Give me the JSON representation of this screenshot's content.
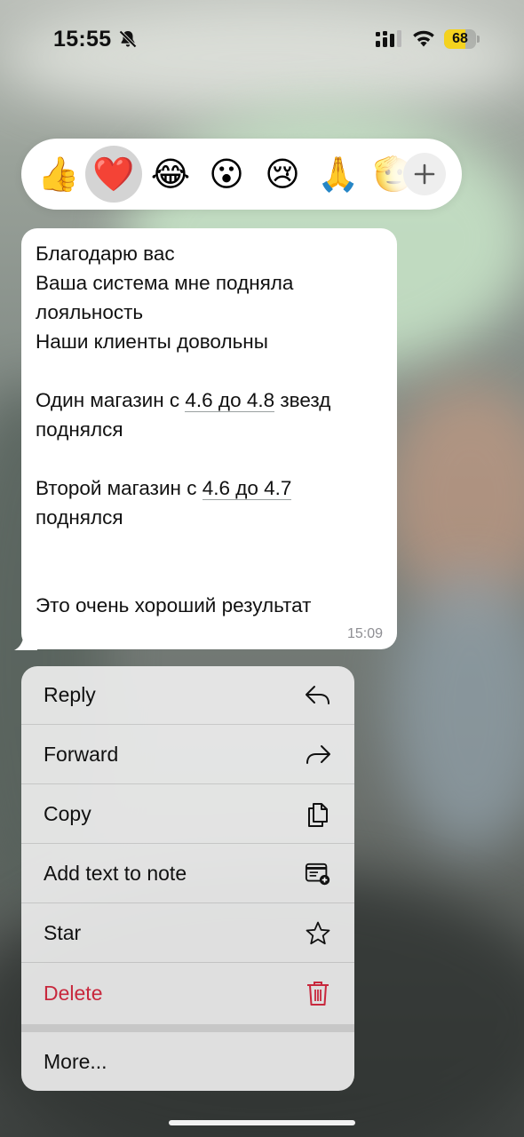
{
  "status_bar": {
    "time": "15:55",
    "silent_icon": "bell-slash-icon",
    "signal_icon": "cellular-signal-icon",
    "wifi_icon": "wifi-icon",
    "battery_level": "68",
    "battery_color": "#f4d21e"
  },
  "reactions": {
    "items": [
      {
        "emoji": "👍",
        "name": "thumbs-up"
      },
      {
        "emoji": "❤️",
        "name": "red-heart",
        "selected": true
      },
      {
        "emoji": "😂",
        "name": "face-with-tears-of-joy"
      },
      {
        "emoji": "😮",
        "name": "face-with-open-mouth"
      },
      {
        "emoji": "😢",
        "name": "crying-face"
      },
      {
        "emoji": "🙏",
        "name": "folded-hands"
      },
      {
        "emoji": "🫡",
        "name": "saluting-face-partial"
      }
    ],
    "more_icon": "plus-icon"
  },
  "message": {
    "lines": [
      "Благодарю вас",
      "Ваша система мне подняла",
      "лояльность",
      "Наши клиенты довольны",
      "",
      "Один магазин с 4.6 до 4.8 звезд",
      "поднялся",
      "",
      "Второй магазин с 4.6 до 4.7",
      "поднялся",
      "",
      "",
      "Это очень хороший результат"
    ],
    "line6_prefix": "Один магазин с ",
    "line6_link": "4.6 до 4.8",
    "line6_suffix": " звезд",
    "line9_prefix": "Второй магазин с ",
    "line9_link": "4.6 до 4.7",
    "time": "15:09"
  },
  "context_menu": {
    "reply": {
      "label": "Reply",
      "icon": "reply-arrow-icon"
    },
    "forward": {
      "label": "Forward",
      "icon": "forward-arrow-icon"
    },
    "copy": {
      "label": "Copy",
      "icon": "copy-icon"
    },
    "add_note": {
      "label": "Add text to note",
      "icon": "add-note-icon"
    },
    "star": {
      "label": "Star",
      "icon": "star-icon"
    },
    "delete": {
      "label": "Delete",
      "icon": "trash-icon",
      "color": "#c8283d"
    },
    "more": {
      "label": "More..."
    }
  }
}
